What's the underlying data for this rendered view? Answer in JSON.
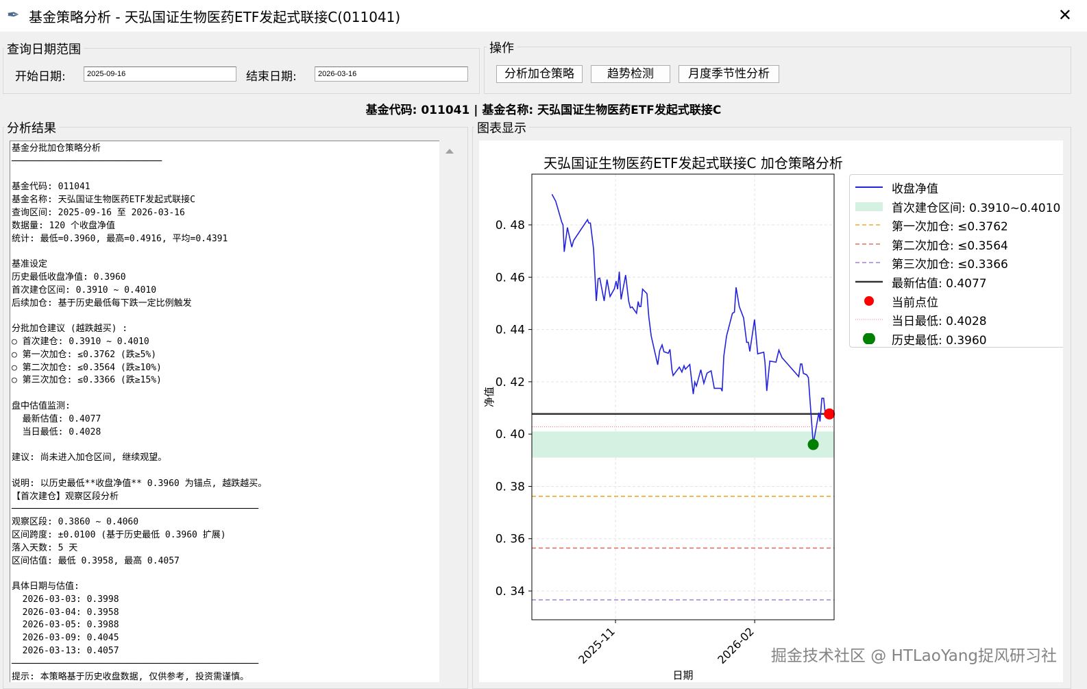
{
  "window": {
    "title": "基金策略分析 - 天弘国证生物医药ETF发起式联接C(011041)",
    "close_icon": "close-icon"
  },
  "query": {
    "group_label": "查询日期范围",
    "start_label": "开始日期:",
    "start_value": "2025-09-16",
    "end_label": "结束日期:",
    "end_value": "2026-03-16"
  },
  "ops": {
    "group_label": "操作",
    "buttons": [
      "分析加仓策略",
      "趋势检测",
      "月度季节性分析"
    ]
  },
  "fund_line": "基金代码: 011041 | 基金名称: 天弘国证生物医药ETF发起式联接C",
  "results": {
    "group_label": "分析结果",
    "lines": [
      "基金分批加仓策略分析",
      "────────────────────────────",
      "",
      "基金代码: 011041",
      "基金名称: 天弘国证生物医药ETF发起式联接C",
      "查询区间: 2025-09-16 至 2026-03-16",
      "数据量: 120 个收盘净值",
      "统计: 最低=0.3960, 最高=0.4916, 平均=0.4391",
      "",
      "基准设定",
      "历史最低收盘净值: 0.3960",
      "首次建仓区间: 0.3910 ~ 0.4010",
      "后续加仓: 基于历史最低每下跌一定比例触发",
      "",
      "分批加仓建议 (越跌越买) :",
      "○ 首次建仓: 0.3910 ~ 0.4010",
      "○ 第一次加仓: ≤0.3762 (跌≥5%)",
      "○ 第二次加仓: ≤0.3564 (跌≥10%)",
      "○ 第三次加仓: ≤0.3366 (跌≥15%)",
      "",
      "盘中估值监测:",
      "  最新估值: 0.4077",
      "  当日最低: 0.4028",
      "",
      "建议: 尚未进入加仓区间, 继续观望。",
      "",
      "说明: 以历史最低**收盘净值** 0.3960 为锚点, 越跌越买。",
      "【首次建仓】观察区段分析",
      "──────────────────────────────────────────────",
      "观察区段: 0.3860 ~ 0.4060",
      "区间跨度: ±0.0100 (基于历史最低 0.3960 扩展)",
      "落入天数: 5 天",
      "区间估值: 最低 0.3958, 最高 0.4057",
      "",
      "具体日期与估值:",
      "  2026-03-03: 0.3998",
      "  2026-03-04: 0.3958",
      "  2026-03-05: 0.3988",
      "  2026-03-09: 0.4045",
      "  2026-03-13: 0.4057",
      "──────────────────────────────────────────────",
      "提示: 本策略基于历史收盘数据, 仅供参考, 投资需谨慎。"
    ]
  },
  "chart_panel": {
    "group_label": "图表显示"
  },
  "watermark": "掘金技术社区 @ HTLaoYang捉风研习社",
  "chart_data": {
    "type": "line",
    "title": "天弘国证生物医药ETF发起式联接C 加仓策略分析",
    "xlabel": "日期",
    "ylabel": "净值",
    "x_unit": "days since 2025-09-16",
    "xlim": [
      -9.3,
      190.5
    ],
    "ylim": [
      0.329,
      0.4994
    ],
    "yticks": [
      0.34,
      0.36,
      0.38,
      0.4,
      0.42,
      0.44,
      0.46,
      0.48
    ],
    "ytick_labels": [
      "0. 34",
      "0. 36",
      "0. 38",
      "0. 40",
      "0. 42",
      "0. 44",
      "0. 46",
      "0. 48"
    ],
    "xticks": [
      46,
      138
    ],
    "xtick_labels": [
      "2025-11",
      "2026-02"
    ],
    "grid": true,
    "legend_position": "outside-right-top",
    "series": [
      {
        "name": "收盘净值",
        "color": "#2222dd",
        "points": [
          [
            4,
            0.4917
          ],
          [
            6.5,
            0.489
          ],
          [
            10.5,
            0.481
          ],
          [
            11.3,
            0.48
          ],
          [
            12.1,
            0.4697
          ],
          [
            14.2,
            0.479
          ],
          [
            17.1,
            0.4715
          ],
          [
            18.3,
            0.474
          ],
          [
            27.5,
            0.482
          ],
          [
            28.3,
            0.4807
          ],
          [
            29.4,
            0.4807
          ],
          [
            31.5,
            0.4708
          ],
          [
            33.3,
            0.4509
          ],
          [
            34.5,
            0.4594
          ],
          [
            35.6,
            0.4596
          ],
          [
            38.5,
            0.4509
          ],
          [
            40.4,
            0.4591
          ],
          [
            42.4,
            0.4526
          ],
          [
            45.3,
            0.4556
          ],
          [
            46.4,
            0.4585
          ],
          [
            47.4,
            0.4554
          ],
          [
            48.5,
            0.4621
          ],
          [
            49.7,
            0.4515
          ],
          [
            52.7,
            0.4608
          ],
          [
            54.7,
            0.4509
          ],
          [
            55.8,
            0.4483
          ],
          [
            57,
            0.4486
          ],
          [
            59.9,
            0.4462
          ],
          [
            61,
            0.4507
          ],
          [
            61.8,
            0.4488
          ],
          [
            62.8,
            0.4488
          ],
          [
            63.9,
            0.4554
          ],
          [
            66.8,
            0.4537
          ],
          [
            68,
            0.4449
          ],
          [
            69.6,
            0.4375
          ],
          [
            73.9,
            0.4265
          ],
          [
            75.2,
            0.4319
          ],
          [
            76.8,
            0.4341
          ],
          [
            78,
            0.4315
          ],
          [
            80.9,
            0.4309
          ],
          [
            82,
            0.4324
          ],
          [
            83.3,
            0.4246
          ],
          [
            84.1,
            0.4224
          ],
          [
            88.2,
            0.4256
          ],
          [
            89.9,
            0.4237
          ],
          [
            91.3,
            0.4261
          ],
          [
            92.2,
            0.4248
          ],
          [
            95.1,
            0.4266
          ],
          [
            97.4,
            0.4153
          ],
          [
            98.4,
            0.4199
          ],
          [
            99.5,
            0.4184
          ],
          [
            102.4,
            0.4246
          ],
          [
            104.4,
            0.4194
          ],
          [
            106.5,
            0.4233
          ],
          [
            109.2,
            0.4242
          ],
          [
            111.3,
            0.4175
          ],
          [
            115.7,
            0.4175
          ],
          [
            116.5,
            0.4164
          ],
          [
            117.6,
            0.4298
          ],
          [
            119.4,
            0.4375
          ],
          [
            123.3,
            0.4462
          ],
          [
            124.6,
            0.4466
          ],
          [
            125.7,
            0.4561
          ],
          [
            127.8,
            0.4488
          ],
          [
            130.7,
            0.4444
          ],
          [
            132.7,
            0.4351
          ],
          [
            133.8,
            0.4351
          ],
          [
            134.8,
            0.4316
          ],
          [
            137.9,
            0.4438
          ],
          [
            140,
            0.4307
          ],
          [
            144,
            0.4313
          ],
          [
            144.8,
            0.4275
          ],
          [
            146,
            0.4165
          ],
          [
            148,
            0.4279
          ],
          [
            152.1,
            0.4275
          ],
          [
            154,
            0.4321
          ],
          [
            156.1,
            0.4292
          ],
          [
            167.1,
            0.422
          ],
          [
            168.3,
            0.4268
          ],
          [
            169.2,
            0.4268
          ],
          [
            170.2,
            0.4232
          ],
          [
            172.3,
            0.4227
          ],
          [
            173.5,
            0.4216
          ],
          [
            176.7,
            0.3961
          ],
          [
            180.4,
            0.4082
          ],
          [
            181.2,
            0.4048
          ],
          [
            182.4,
            0.4137
          ],
          [
            183.6,
            0.4137
          ],
          [
            184.5,
            0.4087
          ]
        ]
      }
    ],
    "band": {
      "name": "首次建仓区间: 0.3910~0.4010",
      "low": 0.391,
      "high": 0.401,
      "color": "#d4f1e2"
    },
    "hlines": [
      {
        "name": "第一次加仓: ≤0.3762",
        "y": 0.3762,
        "color": "#f0a830",
        "style": "dashed"
      },
      {
        "name": "第二次加仓: ≤0.3564",
        "y": 0.3564,
        "color": "#e07060",
        "style": "dashed"
      },
      {
        "name": "第三次加仓: ≤0.3366",
        "y": 0.3366,
        "color": "#a080d0",
        "style": "dashed"
      },
      {
        "name": "最新估值: 0.4077",
        "y": 0.4077,
        "color": "#333333",
        "style": "solid"
      },
      {
        "name": "当日最低: 0.4028",
        "y": 0.4028,
        "color": "#f08080",
        "style": "dotted"
      }
    ],
    "markers": [
      {
        "name": "当前点位",
        "x": 187.4,
        "y": 0.4077,
        "color": "#ff0000"
      },
      {
        "name": "历史最低: 0.3960",
        "x": 176.7,
        "y": 0.396,
        "color": "#008000"
      }
    ],
    "legend": [
      "收盘净值",
      "首次建仓区间: 0.3910~0.4010",
      "第一次加仓: ≤0.3762",
      "第二次加仓: ≤0.3564",
      "第三次加仓: ≤0.3366",
      "最新估值: 0.4077",
      "当前点位",
      "当日最低: 0.4028",
      "历史最低: 0.3960"
    ]
  }
}
